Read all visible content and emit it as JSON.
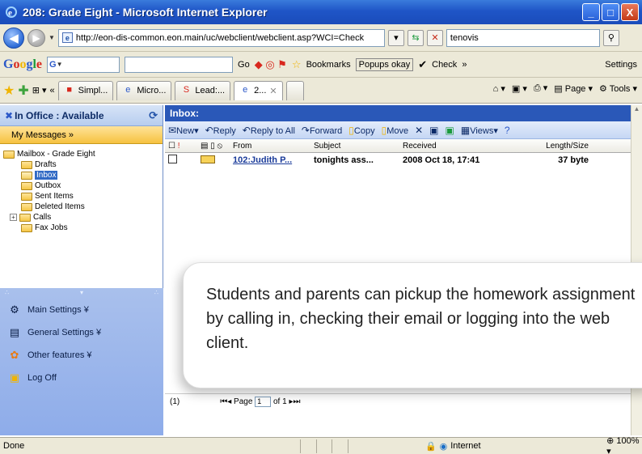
{
  "window": {
    "title": "208: Grade Eight - Microsoft Internet Explorer",
    "min": "_",
    "max": "□",
    "close": "X"
  },
  "address": {
    "url": "http://eon-dis-common.eon.main/uc/webclient/webclient.asp?WCI=Check",
    "search_value": "tenovis"
  },
  "google": {
    "logo": {
      "g": "G",
      "o1": "o",
      "o2": "o",
      "g2": "g",
      "l": "l",
      "e": "e"
    },
    "search_glyph": "G",
    "go": "Go",
    "bookmarks": "Bookmarks",
    "popups": "Popups okay",
    "check": "Check",
    "more": "»",
    "settings": "Settings"
  },
  "tabs": [
    {
      "label": "Simpl..."
    },
    {
      "label": "Micro..."
    },
    {
      "label": "Lead:..."
    },
    {
      "label": "2..."
    }
  ],
  "favright": {
    "page": "Page",
    "tools": "Tools"
  },
  "sidebar": {
    "status": "In Office : Available",
    "my_messages": "My Messages »",
    "mailbox": "Mailbox - Grade Eight",
    "folders": [
      "Drafts",
      "Inbox",
      "Outbox",
      "Sent Items",
      "Deleted Items",
      "Calls",
      "Fax Jobs"
    ],
    "menu": [
      "Main Settings ¥",
      "General Settings ¥",
      "Other features ¥",
      "Log Off"
    ]
  },
  "inbox": {
    "heading": "Inbox:",
    "toolbar": [
      "New",
      "Reply",
      "Reply to All",
      "Forward",
      "Copy",
      "Move",
      "Views"
    ],
    "columns": {
      "from": "From",
      "subject": "Subject",
      "received": "Received",
      "size": "Length/Size"
    },
    "messages": [
      {
        "from": "102:Judith P...",
        "subject": "tonights ass...",
        "received": "2008 Oct 18, 17:41",
        "size": "37 byte"
      }
    ],
    "pager": {
      "count": "(1)",
      "page_label": "Page",
      "page_value": "1",
      "of": "of 1"
    }
  },
  "callout": "Students and parents can pickup the homework assignment by calling in, checking their email or logging into the web client.",
  "status": {
    "text": "Done",
    "zone": "Internet",
    "zoom": "100%"
  },
  "colors": {
    "title_blue": "#1f55c7",
    "inbox_header": "#2a58b8",
    "sidebar_blue": "#8eacea",
    "my_messages": "#f6c240"
  }
}
